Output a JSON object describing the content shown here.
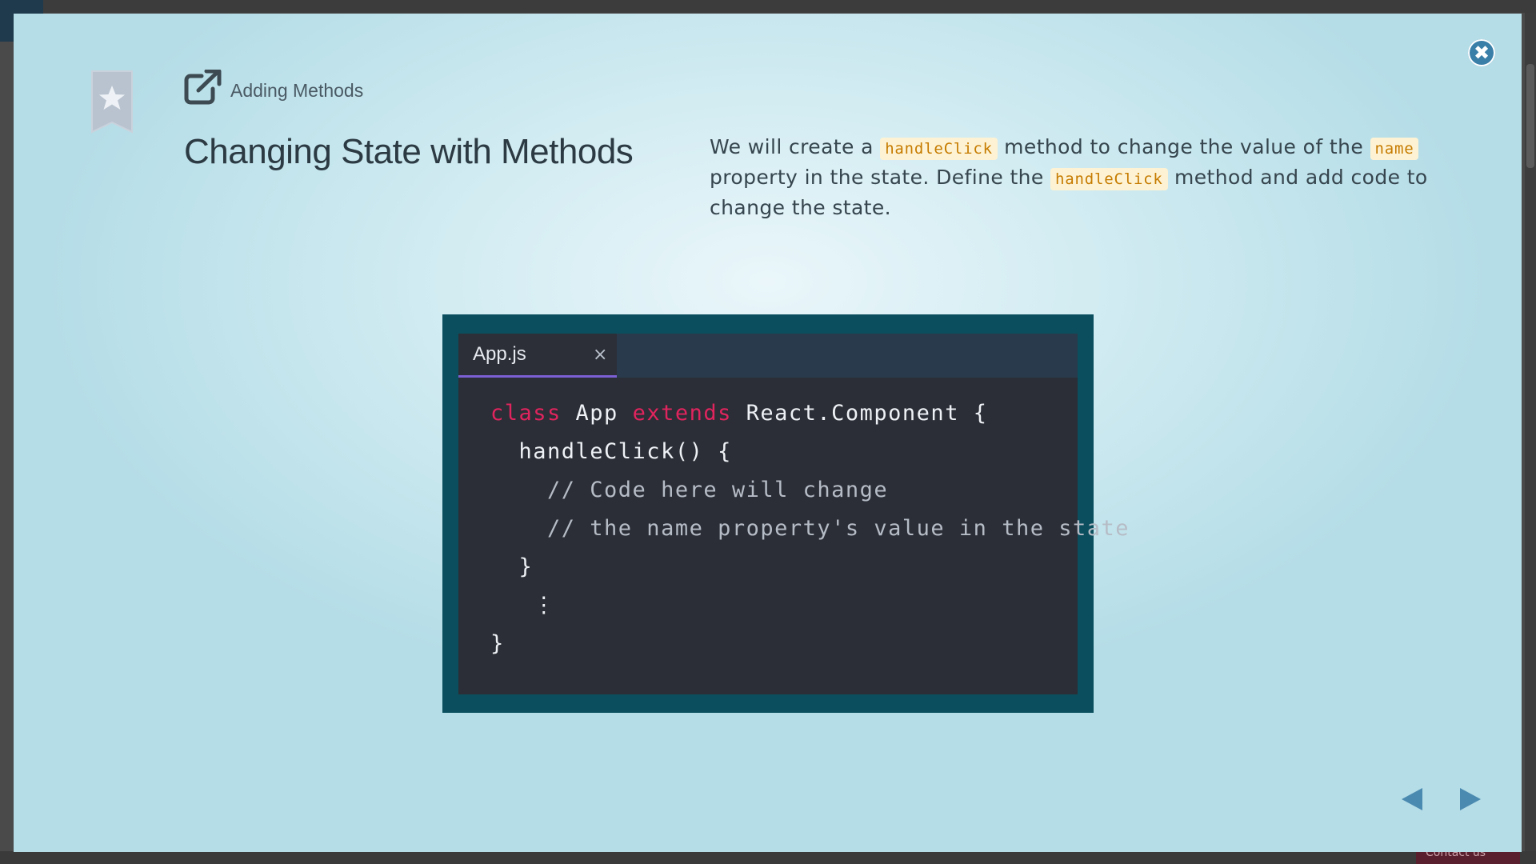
{
  "lesson": {
    "section_label": "Adding Methods",
    "title": "Changing State with Methods",
    "description": {
      "p1": "We will create a ",
      "code1": "handleClick",
      "p2": " method to change the value of the ",
      "code2": "name",
      "p3": " property in the state. Define the ",
      "code3": "handleClick",
      "p4": " method and add code to change the state."
    }
  },
  "editor": {
    "tab_label": "App.js",
    "tab_close": "×",
    "lines": [
      {
        "kw1": "class",
        "t1": " App ",
        "kw2": "extends",
        "t2": " React.Component {"
      },
      {
        "text": "  handleClick() {"
      },
      {
        "comment": "    // Code here will change"
      },
      {
        "comment": "    // the name property's value in the state"
      },
      {
        "text": "  }"
      },
      {
        "text": "   ⋮"
      },
      {
        "text": "}"
      }
    ]
  },
  "controls": {
    "close_glyph": "✖",
    "prev_glyph": "◀",
    "next_glyph": "▶"
  },
  "background": {
    "contact_label": "Contact us"
  },
  "colors": {
    "accent": "#3a7fa8",
    "keyword": "#e0245e",
    "code_chip_text": "#c67b00",
    "editor_frame": "#0b4f5e",
    "tab_underline": "#7b5fd4"
  },
  "icons": {
    "bookmark": "bookmark-star-icon",
    "external_link": "external-link-icon",
    "close": "close-circle-icon",
    "prev": "arrow-left-icon",
    "next": "arrow-right-icon"
  }
}
